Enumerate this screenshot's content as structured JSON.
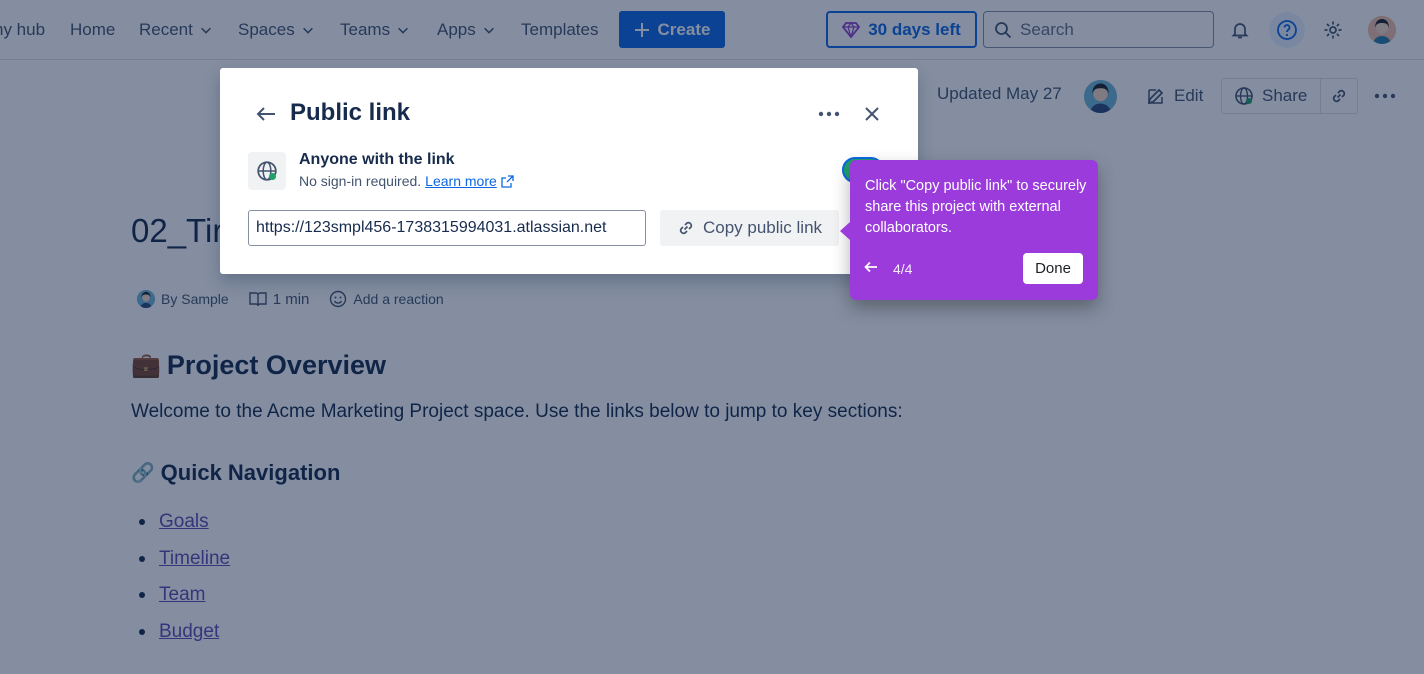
{
  "topnav": {
    "items": [
      {
        "label": "ny hub",
        "has_chevron": false
      },
      {
        "label": "Home",
        "has_chevron": false
      },
      {
        "label": "Recent",
        "has_chevron": true
      },
      {
        "label": "Spaces",
        "has_chevron": true
      },
      {
        "label": "Teams",
        "has_chevron": true
      },
      {
        "label": "Apps",
        "has_chevron": true
      },
      {
        "label": "Templates",
        "has_chevron": false
      }
    ],
    "create_label": "Create",
    "trial_label": "30 days left",
    "search_placeholder": "Search"
  },
  "page_header": {
    "updated": "Updated May 27",
    "edit_label": "Edit",
    "share_label": "Share"
  },
  "content": {
    "title": "02_Tir",
    "byline_author": "By Sample",
    "read_time": "1 min",
    "add_reaction": "Add a reaction",
    "section1_emoji": "💼",
    "section1_title": "Project Overview",
    "paragraph": "Welcome to the Acme Marketing Project space. Use the links below to jump to key sections:",
    "section2_emoji": "🔗",
    "section2_title": "Quick Navigation",
    "links": [
      "Goals",
      "Timeline",
      "Team",
      "Budget"
    ]
  },
  "modal": {
    "title": "Public link",
    "access_label": "Anyone with the link",
    "signin_text": "No sign-in required.",
    "learn_more": "Learn more",
    "url": "https://123smpl456-1738315994031.atlassian.net",
    "copy_label": "Copy public link",
    "toggle_on": true
  },
  "tooltip": {
    "text": "Click \"Copy public link\" to securely share this project with external collaborators.",
    "step": "4/4",
    "done_label": "Done",
    "color": "#9b3bdc"
  },
  "colors": {
    "primary": "#0c66e4",
    "toggle_on": "#22a06b"
  }
}
